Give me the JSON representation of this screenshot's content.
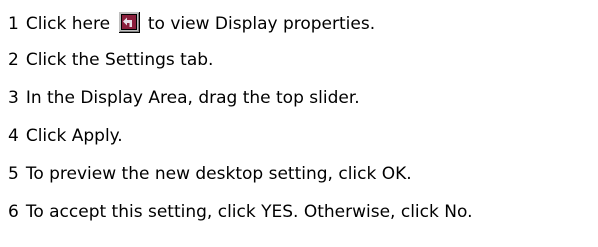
{
  "steps": [
    {
      "num": "1",
      "before": "Click here",
      "after": "to view Display properties."
    },
    {
      "num": "2",
      "text": "Click the Settings tab."
    },
    {
      "num": "3",
      "text": "In the Display Area, drag the top slider."
    },
    {
      "num": "4",
      "text": "Click Apply."
    },
    {
      "num": "5",
      "text": "To preview the new desktop setting, click OK."
    },
    {
      "num": "6",
      "text": "To accept this setting, click YES. Otherwise, click No."
    }
  ],
  "shortcut_icon": "shortcut-arrow-icon"
}
